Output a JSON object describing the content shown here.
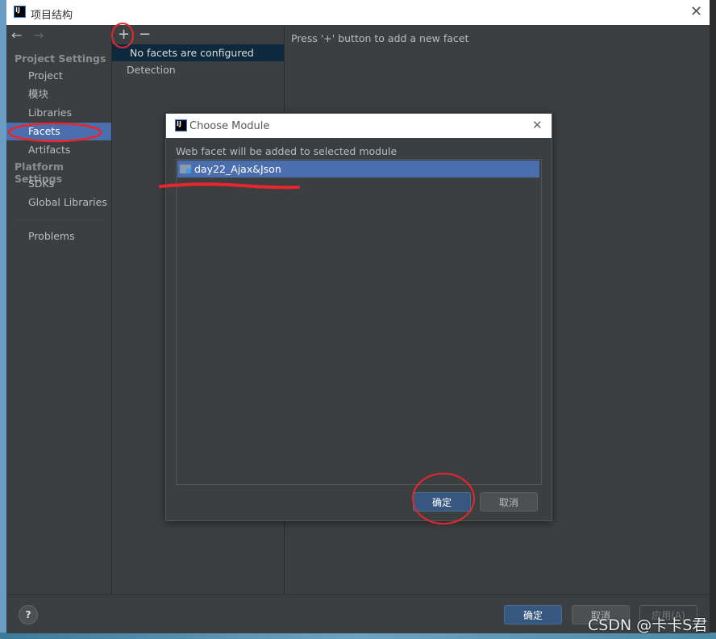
{
  "window": {
    "title": "项目结构"
  },
  "sidebar": {
    "nav_back": "←",
    "nav_forward": "→",
    "project_settings_header": "Project Settings",
    "items": [
      {
        "label": "Project"
      },
      {
        "label": "模块"
      },
      {
        "label": "Libraries"
      },
      {
        "label": "Facets",
        "selected": true
      },
      {
        "label": "Artifacts"
      }
    ],
    "platform_settings_header": "Platform Settings",
    "platform_items": [
      {
        "label": "SDKs"
      },
      {
        "label": "Global Libraries"
      }
    ],
    "problems": "Problems"
  },
  "middle": {
    "add": "+",
    "remove": "−",
    "no_facets": "No facets are configured",
    "detection": "Detection"
  },
  "right": {
    "hint": "Press '+' button to add a new facet"
  },
  "dialog": {
    "title": "Choose Module",
    "prompt": "Web facet will be added to selected module",
    "modules": [
      {
        "label": "day22_Ajax&Json",
        "selected": true
      }
    ],
    "ok": "确定",
    "cancel": "取消"
  },
  "footer": {
    "help": "?",
    "ok": "确定",
    "cancel": "取消",
    "apply": "应用(A)"
  },
  "watermark": "CSDN @卡卡S君",
  "colors": {
    "selection": "#4b6eaf",
    "default_button": "#365880",
    "annotation": "#e8262b"
  }
}
